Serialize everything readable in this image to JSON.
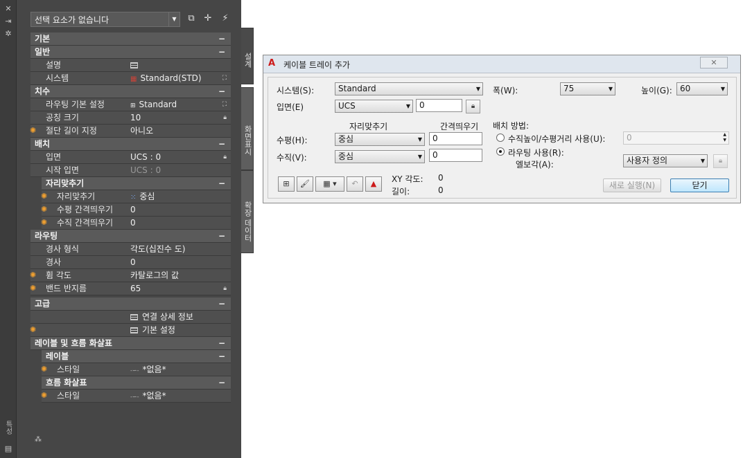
{
  "palette": {
    "selection_combo": "선택 요소가 없습니다",
    "tab_design": "설계",
    "tab_display": "화면표시",
    "tab_extended": "확장 데이터",
    "bottom_label": "특성",
    "sections": {
      "basic": "기본",
      "general": "일반",
      "description_label": "설명",
      "system_label": "시스템",
      "system_value": "Standard(STD)",
      "dimensions": "치수",
      "routing_pref_label": "라우팅 기본 설정",
      "routing_pref_value": "Standard",
      "nominal_size_label": "공칭 크기",
      "nominal_size_value": "10",
      "cut_length_label": "절단 길이 지정",
      "cut_length_value": "아니오",
      "placement": "배치",
      "elevation_label": "입면",
      "elevation_value": "UCS : 0",
      "start_elev_label": "시작 입면",
      "start_elev_value": "UCS : 0",
      "justification_group": "자리맞추기",
      "justification_label": "자리맞추기",
      "justification_value": "중심",
      "h_offset_label": "수평 간격띄우기",
      "h_offset_value": "0",
      "v_offset_label": "수직 간격띄우기",
      "v_offset_value": "0",
      "routing": "라우팅",
      "slope_format_label": "경사 형식",
      "slope_format_value": "각도(십진수 도)",
      "slope_label": "경사",
      "slope_value": "0",
      "bend_angle_label": "휨 각도",
      "bend_angle_value": "카탈로그의 값",
      "bend_radius_label": "밴드 반지름",
      "bend_radius_value": "65",
      "advanced": "고급",
      "connection_details": "연결 상세 정보",
      "basic_settings": "기본 설정",
      "labels_flow": "레이블 및 흐름 화살표",
      "labels": "레이블",
      "label_style_label": "스타일",
      "label_style_value": "*없음*",
      "flow_arrows": "흐름 화살표",
      "flow_style_label": "스타일",
      "flow_style_value": "*없음*"
    }
  },
  "dialog": {
    "title": "케이블 트레이 추가",
    "system_label": "시스템(S):",
    "system_value": "Standard",
    "elevation_label": "입면(E)",
    "elevation_ref": "UCS",
    "elevation_value": "0",
    "justification_header": "자리맞추기",
    "offset_header": "간격띄우기",
    "horizontal_label": "수평(H):",
    "horizontal_value": "중심",
    "horizontal_offset": "0",
    "vertical_label": "수직(V):",
    "vertical_value": "중심",
    "vertical_offset": "0",
    "width_label": "폭(W):",
    "width_value": "75",
    "height_label": "높이(G):",
    "height_value": "60",
    "placement_label": "배치 방법:",
    "radio_vertical": "수직높이/수평거리 사용(U):",
    "radio_vertical_value": "0",
    "radio_routing": "라우팅 사용(R):",
    "elbow_label": "엘보각(A):",
    "elbow_value": "사용자 정의",
    "xy_angle_label": "XY 각도:",
    "xy_angle_value": "0",
    "length_label": "길이:",
    "length_value": "0",
    "new_run_button": "새로 실행(N)",
    "close_button": "닫기"
  }
}
